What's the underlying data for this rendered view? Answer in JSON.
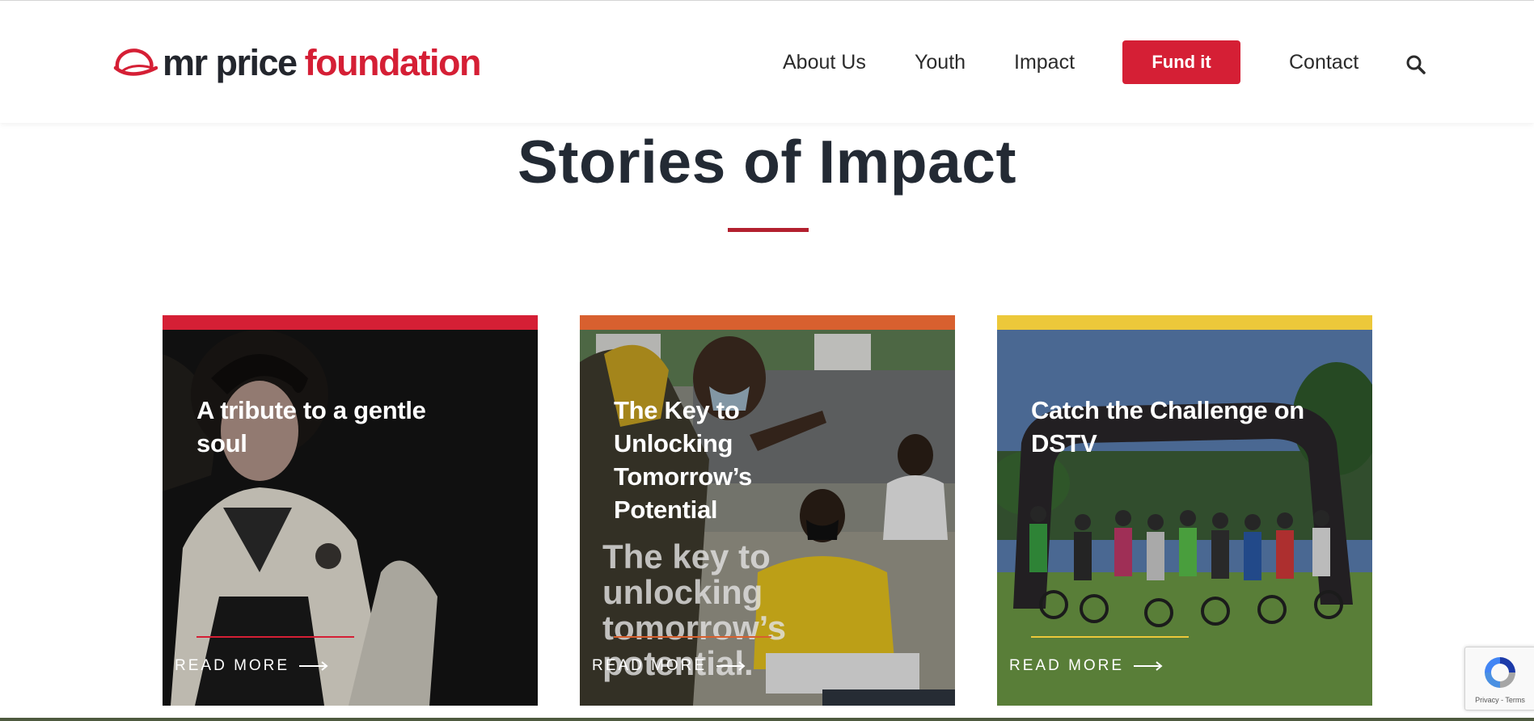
{
  "header": {
    "logo": {
      "text_primary": "mr price",
      "text_secondary": "foundation"
    },
    "nav": [
      {
        "label": "About Us"
      },
      {
        "label": "Youth"
      },
      {
        "label": "Impact"
      },
      {
        "label": "Contact"
      }
    ],
    "cta_label": "Fund it",
    "search_icon": "search-icon"
  },
  "section": {
    "title": "Stories of Impact"
  },
  "cards": [
    {
      "title": "A tribute to a gentle soul",
      "read_more": "READ MORE",
      "accent_color": "#d51f35",
      "image_alt": "portrait of a woman in a cardigan"
    },
    {
      "title": "The Key to Unlocking Tomorrow’s Potential",
      "read_more": "READ MORE",
      "accent_color": "#d8602f",
      "overlay_text": "The key to unlocking tomorrow’s potential.",
      "image_alt": "teacher helping students in a classroom"
    },
    {
      "title": "Catch the Challenge on DSTV",
      "read_more": "READ MORE",
      "accent_color": "#ecc83a",
      "image_alt": "cyclists celebrating under an inflatable arch"
    }
  ],
  "recaptcha": {
    "footer": "Privacy - Terms"
  },
  "colors": {
    "brand_red": "#d51f35",
    "heading": "#232a34",
    "orange": "#d8602f",
    "yellow": "#ecc83a"
  }
}
